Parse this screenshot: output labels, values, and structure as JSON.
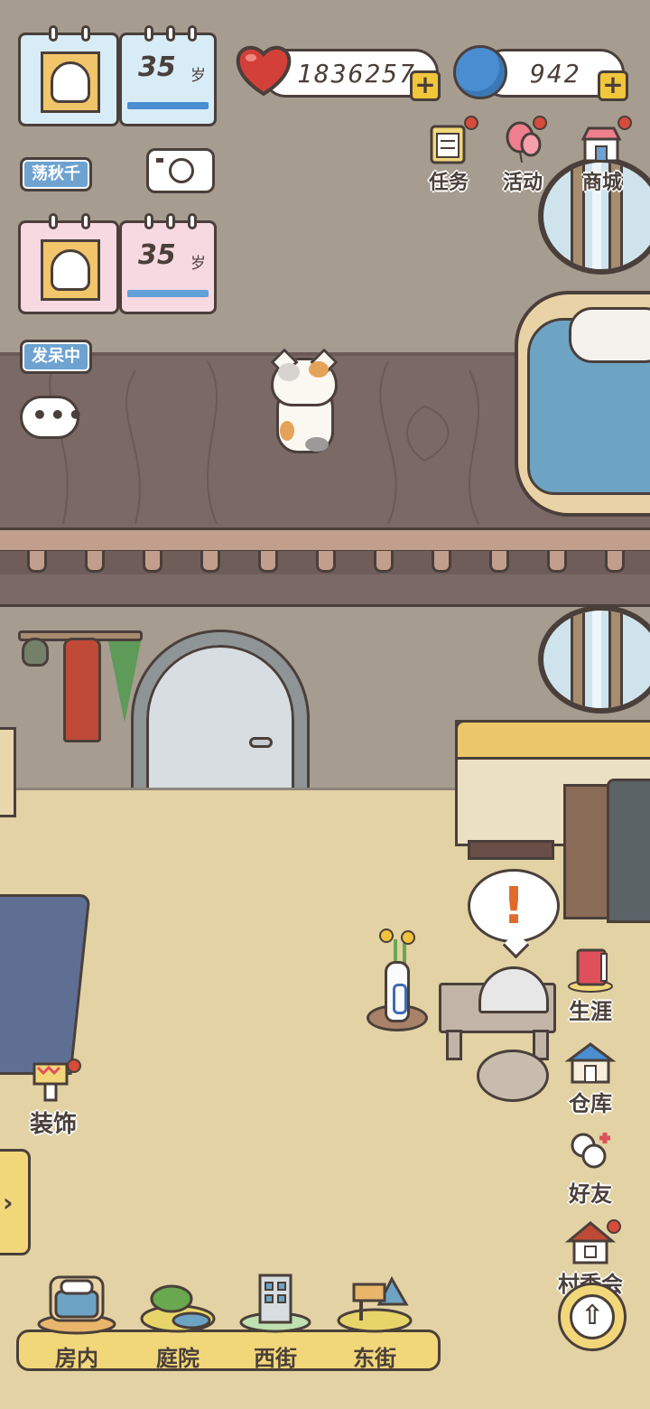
{
  "pets": [
    {
      "age": "35",
      "unit": "岁",
      "status": "荡秋千",
      "bg": "#d7ecf6",
      "info_bg": "#d7ecf6"
    },
    {
      "age": "35",
      "unit": "岁",
      "status": "发呆中",
      "bg": "#f7d9e2",
      "info_bg": "#f7d9e2"
    }
  ],
  "currency": {
    "hearts": "1836257",
    "gems": "942",
    "plus_symbol": "+"
  },
  "top_menu": [
    {
      "label": "任务",
      "icon": "task-board-icon",
      "badge": true
    },
    {
      "label": "活动",
      "icon": "balloon-icon",
      "badge": true
    },
    {
      "label": "商城",
      "icon": "shop-icon",
      "badge": true
    }
  ],
  "chat": {
    "text": "•••"
  },
  "speech_bubble": {
    "text": "!"
  },
  "side_menu": [
    {
      "label": "生涯",
      "icon": "diary-book-icon",
      "badge": false
    },
    {
      "label": "仓库",
      "icon": "warehouse-icon",
      "badge": false
    },
    {
      "label": "好友",
      "icon": "friends-icon",
      "badge": false
    },
    {
      "label": "村委会",
      "icon": "village-hall-icon",
      "badge": true
    }
  ],
  "decorate": {
    "label": "装饰",
    "icon": "paint-brush-icon",
    "badge": true
  },
  "drawer_toggle": {
    "text": "›"
  },
  "bottom_nav": [
    {
      "label": "房内",
      "icon": "bed-room-icon"
    },
    {
      "label": "庭院",
      "icon": "garden-icon"
    },
    {
      "label": "西街",
      "icon": "west-street-building-icon"
    },
    {
      "label": "东街",
      "icon": "east-street-sign-icon"
    }
  ],
  "scroll_up": {
    "text": "⇧"
  },
  "colors": {
    "outline": "#4a3f3a",
    "accent_yellow": "#f1d77a",
    "tag_blue": "#6da2d1",
    "badge_red": "#d64b3c"
  }
}
